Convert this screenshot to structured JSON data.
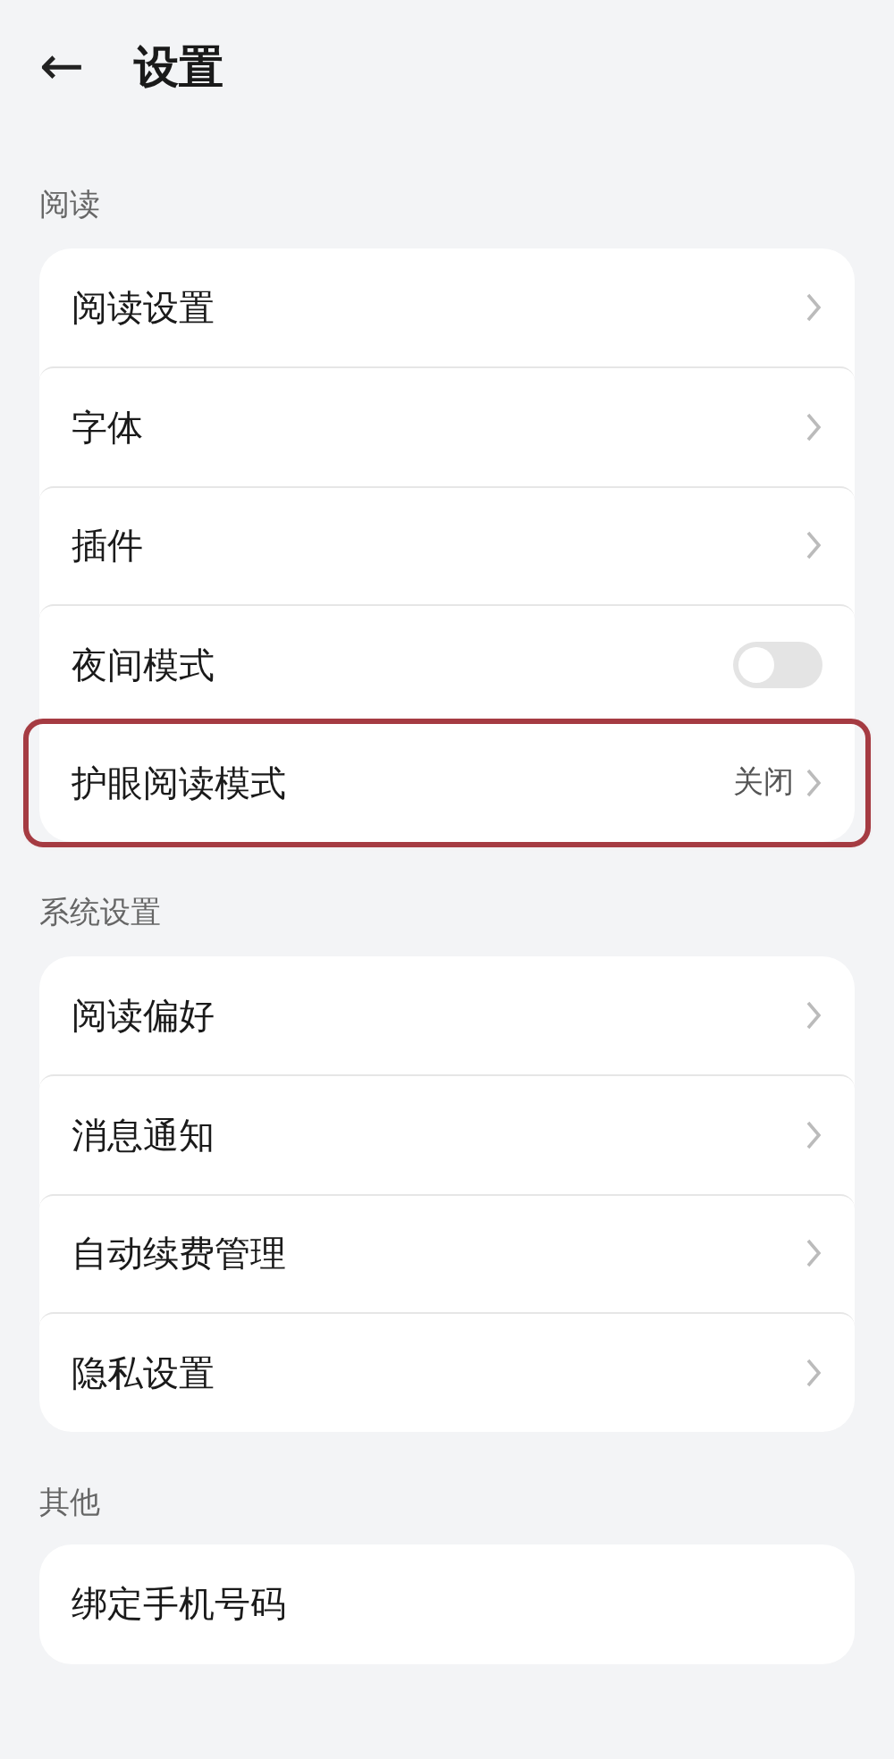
{
  "header": {
    "back": "←",
    "title": "设置"
  },
  "sections": [
    {
      "title": "阅读",
      "items": [
        {
          "label": "阅读设置",
          "kind": "link",
          "highlighted": false
        },
        {
          "label": "字体",
          "kind": "link",
          "highlighted": false
        },
        {
          "label": "插件",
          "kind": "link",
          "highlighted": false
        },
        {
          "label": "夜间模式",
          "kind": "toggle",
          "on": false,
          "highlighted": false
        },
        {
          "label": "护眼阅读模式",
          "kind": "link",
          "value": "关闭",
          "highlighted": true
        }
      ]
    },
    {
      "title": "系统设置",
      "items": [
        {
          "label": "阅读偏好",
          "kind": "link",
          "highlighted": false
        },
        {
          "label": "消息通知",
          "kind": "link",
          "highlighted": false
        },
        {
          "label": "自动续费管理",
          "kind": "link",
          "highlighted": false
        },
        {
          "label": "隐私设置",
          "kind": "link",
          "highlighted": false
        }
      ]
    },
    {
      "title": "其他",
      "items": [
        {
          "label": "绑定手机号码",
          "kind": "plain",
          "highlighted": false
        }
      ]
    }
  ]
}
